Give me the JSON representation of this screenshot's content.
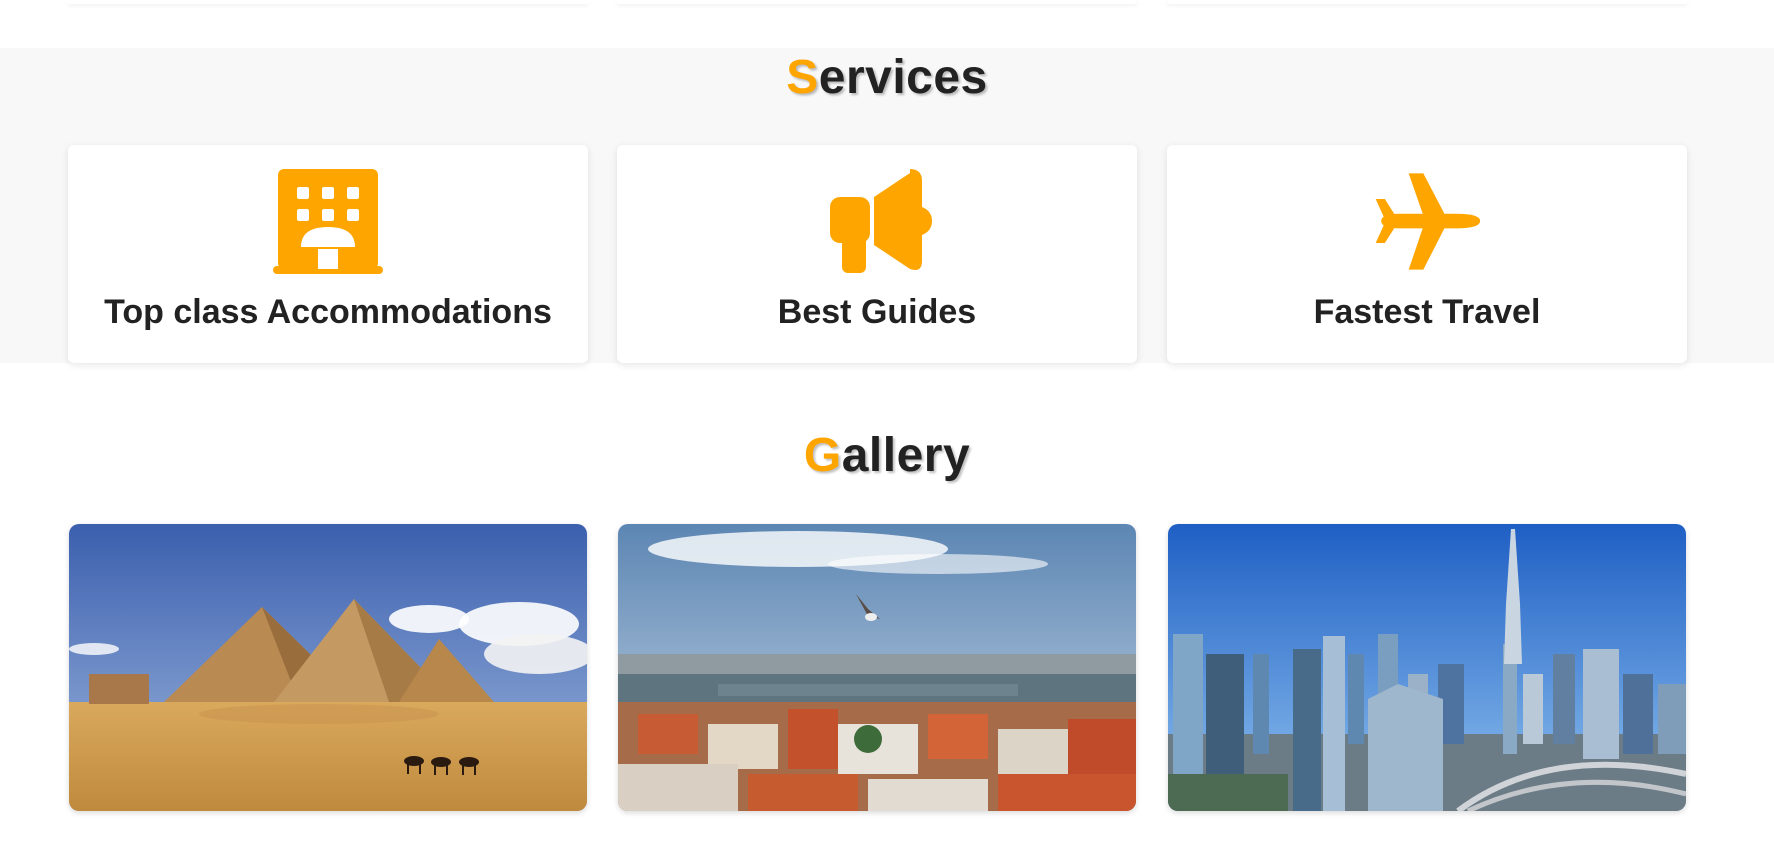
{
  "colors": {
    "accent": "#ffa500",
    "text": "#222222",
    "band": "#f8f8f8"
  },
  "services": {
    "title_first": "S",
    "title_rest": "ervices",
    "cards": [
      {
        "icon": "hotel-icon",
        "label": "Top class Accommodations"
      },
      {
        "icon": "megaphone-icon",
        "label": "Best Guides"
      },
      {
        "icon": "plane-icon",
        "label": "Fastest Travel"
      }
    ]
  },
  "gallery": {
    "title_first": "G",
    "title_rest": "allery",
    "images": [
      {
        "name": "pyramids-photo"
      },
      {
        "name": "istanbul-photo"
      },
      {
        "name": "dubai-skyline-photo"
      }
    ]
  }
}
